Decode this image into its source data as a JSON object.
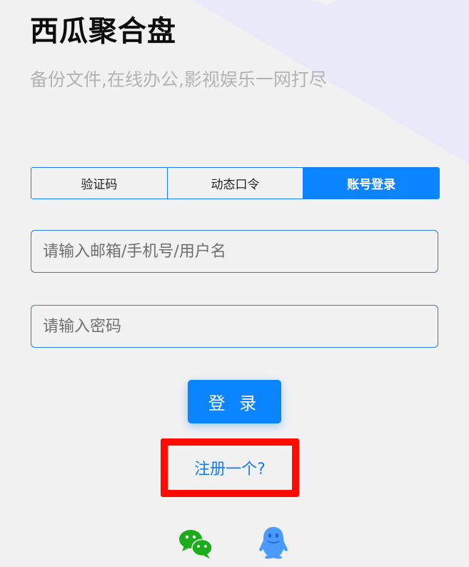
{
  "app": {
    "title": "西瓜聚合盘",
    "subtitle": "备份文件,在线办公,影视娱乐一网打尽"
  },
  "tabs": [
    {
      "label": "验证码",
      "active": false
    },
    {
      "label": "动态口令",
      "active": false
    },
    {
      "label": "账号登录",
      "active": true
    }
  ],
  "form": {
    "username_placeholder": "请输入邮箱/手机号/用户名",
    "username_value": "",
    "password_placeholder": "请输入密码",
    "password_value": "",
    "login_label": "登 录",
    "register_label": "注册一个?"
  },
  "social": [
    {
      "name": "wechat-icon"
    },
    {
      "name": "qq-icon"
    }
  ],
  "colors": {
    "accent": "#0a84ff",
    "highlight": "#ff0b00",
    "link": "#1a7bf0",
    "background": "#f1f1f2"
  }
}
